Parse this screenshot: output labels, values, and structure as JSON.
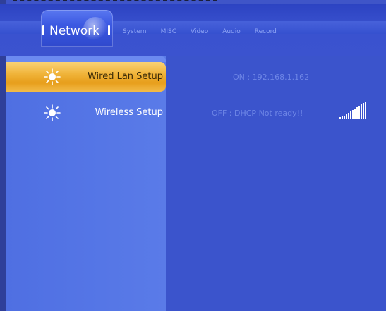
{
  "header": {
    "active_tab": "Network",
    "tabs": [
      "System",
      "MISC",
      "Video",
      "Audio",
      "Record"
    ]
  },
  "menu": {
    "items": [
      {
        "label": "Wired Lan Setup",
        "value": "ON : 192.168.1.162",
        "selected": true,
        "icon": "sun-icon"
      },
      {
        "label": "Wireless Setup",
        "value": "OFF : DHCP Not ready!!",
        "selected": false,
        "icon": "sun-icon"
      }
    ]
  },
  "status": {
    "signal_icon": "signal-strength-icon",
    "signal_level": 1.0
  },
  "colors": {
    "background": "#3f55c8",
    "sidebar": "#5576e6",
    "selection": "#f0b43a",
    "value_text": "#6e86e6"
  }
}
